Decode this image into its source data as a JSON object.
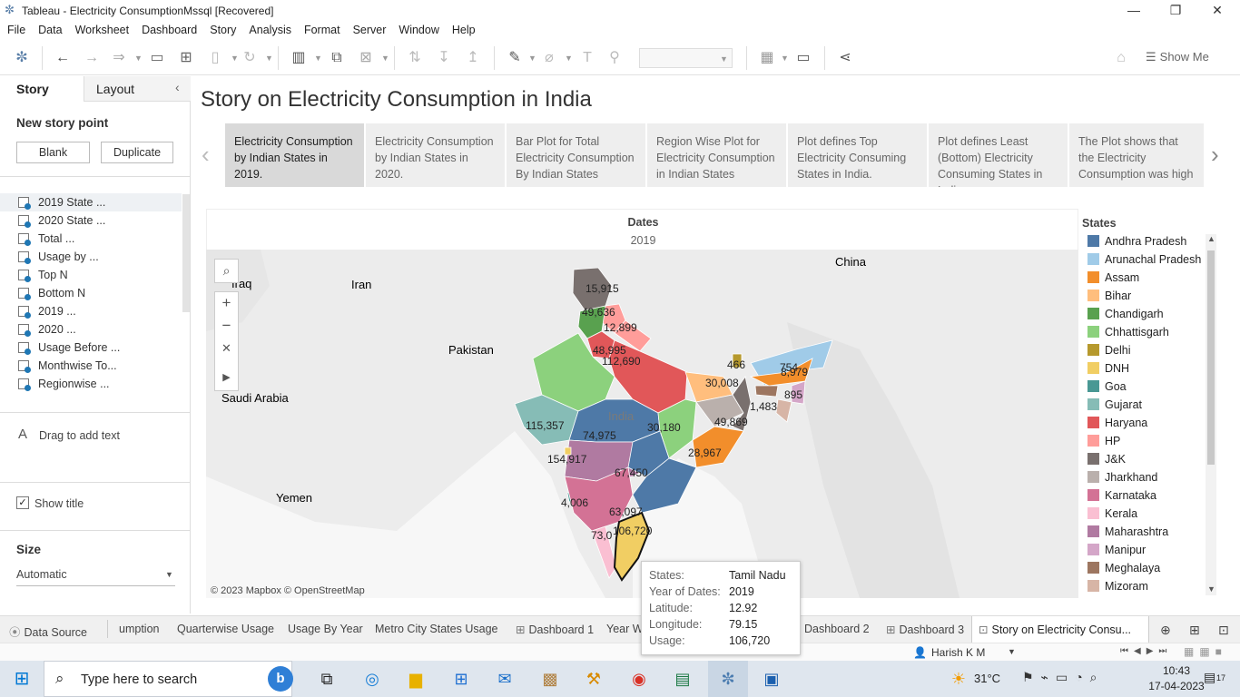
{
  "window": {
    "title": "Tableau - Electricity ConsumptionMssql [Recovered]"
  },
  "menu": [
    "File",
    "Data",
    "Worksheet",
    "Dashboard",
    "Story",
    "Analysis",
    "Format",
    "Server",
    "Window",
    "Help"
  ],
  "toolbar": {
    "show_me": "Show Me"
  },
  "left_pane": {
    "tab_story": "Story",
    "tab_layout": "Layout",
    "new_story_point": "New story point",
    "blank": "Blank",
    "duplicate": "Duplicate",
    "sheets": [
      "2019 State ...",
      "2020 State ...",
      "Total ...",
      "Usage by ...",
      "Top N",
      "Bottom N",
      "2019 ...",
      "2020 ...",
      "Usage Before ...",
      "Monthwise To...",
      "Regionwise ..."
    ],
    "drag_text": "Drag to add text",
    "show_title": "Show title",
    "size_label": "Size",
    "size_value": "Automatic"
  },
  "story": {
    "title": "Story on Electricity Consumption in India",
    "points": [
      "Electricity Consumption by Indian States in 2019.",
      "Electricity Consumption by Indian States in 2020.",
      "Bar Plot for Total Electricity Consumption By Indian States",
      "Region Wise Plot for Electricity Consumption in Indian States",
      "Plot defines Top Electricity Consuming States in India.",
      "Plot defines Least (Bottom) Electricity Consuming States in India",
      "The Plot shows that the Electricity Consumption was high"
    ]
  },
  "viz": {
    "header_label": "Dates",
    "header_value": "2019",
    "attribution": "© 2023 Mapbox © OpenStreetMap",
    "map_labels": {
      "iraq": "Iraq",
      "iran": "Iran",
      "pakistan": "Pakistan",
      "saudi": "Saudi Arabia",
      "yemen": "Yemen",
      "china": "China",
      "india": "India"
    },
    "values": [
      "15,915",
      "49,636",
      "12,899",
      "48,995",
      "112,690",
      "466",
      "754",
      "8,979",
      "30,008",
      "1,483",
      "895",
      "115,357",
      "30,180",
      "49,869",
      "74,975",
      "28,967",
      "154,917",
      "67,450",
      "4,006",
      "63,097",
      "106,720",
      "73,0"
    ]
  },
  "legend": {
    "title": "States",
    "items": [
      {
        "name": "Andhra Pradesh",
        "color": "#4e79a7"
      },
      {
        "name": "Arunachal Pradesh",
        "color": "#a0cbe8"
      },
      {
        "name": "Assam",
        "color": "#f28e2b"
      },
      {
        "name": "Bihar",
        "color": "#ffbe7d"
      },
      {
        "name": "Chandigarh",
        "color": "#59a14f"
      },
      {
        "name": "Chhattisgarh",
        "color": "#8cd17d"
      },
      {
        "name": "Delhi",
        "color": "#b6992d"
      },
      {
        "name": "DNH",
        "color": "#f1ce63"
      },
      {
        "name": "Goa",
        "color": "#499894"
      },
      {
        "name": "Gujarat",
        "color": "#86bcb6"
      },
      {
        "name": "Haryana",
        "color": "#e15759"
      },
      {
        "name": "HP",
        "color": "#ff9d9a"
      },
      {
        "name": "J&K",
        "color": "#79706e"
      },
      {
        "name": "Jharkhand",
        "color": "#bab0ac"
      },
      {
        "name": "Karnataka",
        "color": "#d37295"
      },
      {
        "name": "Kerala",
        "color": "#fabfd2"
      },
      {
        "name": "Maharashtra",
        "color": "#b07aa1"
      },
      {
        "name": "Manipur",
        "color": "#d4a6c8"
      },
      {
        "name": "Meghalaya",
        "color": "#9d7660"
      },
      {
        "name": "Mizoram",
        "color": "#d7b5a6"
      }
    ]
  },
  "tooltip": {
    "k1": "States:",
    "v1": "Tamil Nadu",
    "k2": "Year of Dates:",
    "v2": "2019",
    "k3": "Latitude:",
    "v3": "12.92",
    "k4": "Longitude:",
    "v4": "79.15",
    "k5": "Usage:",
    "v5": "106,720"
  },
  "sheet_tabs": [
    "Data Source",
    "umption",
    "Quarterwise Usage",
    "Usage By Year",
    "Metro City States Usage",
    "Dashboard 1",
    "Year W",
    "Dashboard 2",
    "Dashboard 3",
    "Story on Electricity Consu..."
  ],
  "status": {
    "user": "Harish K M"
  },
  "taskbar": {
    "search_placeholder": "Type here to search",
    "temp": "31°C",
    "time": "10:43",
    "date": "17-04-2023",
    "notif": "17"
  }
}
